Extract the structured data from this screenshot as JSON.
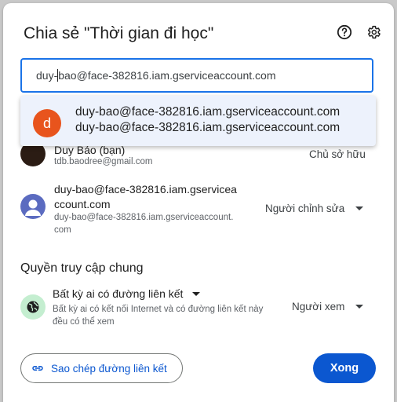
{
  "dialog": {
    "title": "Chia sẻ \"Thời gian đi học\"",
    "help_icon": "help-circle-icon",
    "settings_icon": "gear-icon"
  },
  "search": {
    "value_before_caret": "duy-",
    "value_after_caret": "bao@face-382816.iam.gserviceaccount.com"
  },
  "suggestion": {
    "avatar_letter": "d",
    "primary": "duy-bao@face-382816.iam.gserviceaccount.com",
    "secondary": "duy-bao@face-382816.iam.gserviceaccount.com"
  },
  "people": [
    {
      "name": "Duy Bảo (bạn)",
      "email": "tdb.baodree@gmail.com",
      "role": "Chủ sở hữu"
    },
    {
      "name_line1": "duy-bao@face-382816.iam.gserviceacc",
      "name_line2": "ccount.com",
      "name_line1_exact": "duy-bao@face-382816.iam.gservicea",
      "email_line1": "duy-bao@face-382816.iam.gserviceaccount.",
      "email_line2": "com",
      "role": "Người chỉnh sửa"
    }
  ],
  "general_access": {
    "section_title": "Quyền truy cập chung",
    "link_setting": "Bất kỳ ai có đường liên kết",
    "description_line1": "Bất kỳ ai có kết nối Internet và có đường liên kết này",
    "description_line2": "đều có thể xem",
    "role": "Người xem",
    "icon": "globe-icon"
  },
  "footer": {
    "copy_link_label": "Sao chép đường liên kết",
    "copy_link_icon": "link-icon",
    "done_label": "Xong"
  },
  "colors": {
    "accent": "#0b57d0",
    "focus_border": "#1a73e8",
    "suggestion_bg": "#edf2fc",
    "avatar_orange": "#e8541d",
    "globe_bg": "#c4eed0"
  }
}
